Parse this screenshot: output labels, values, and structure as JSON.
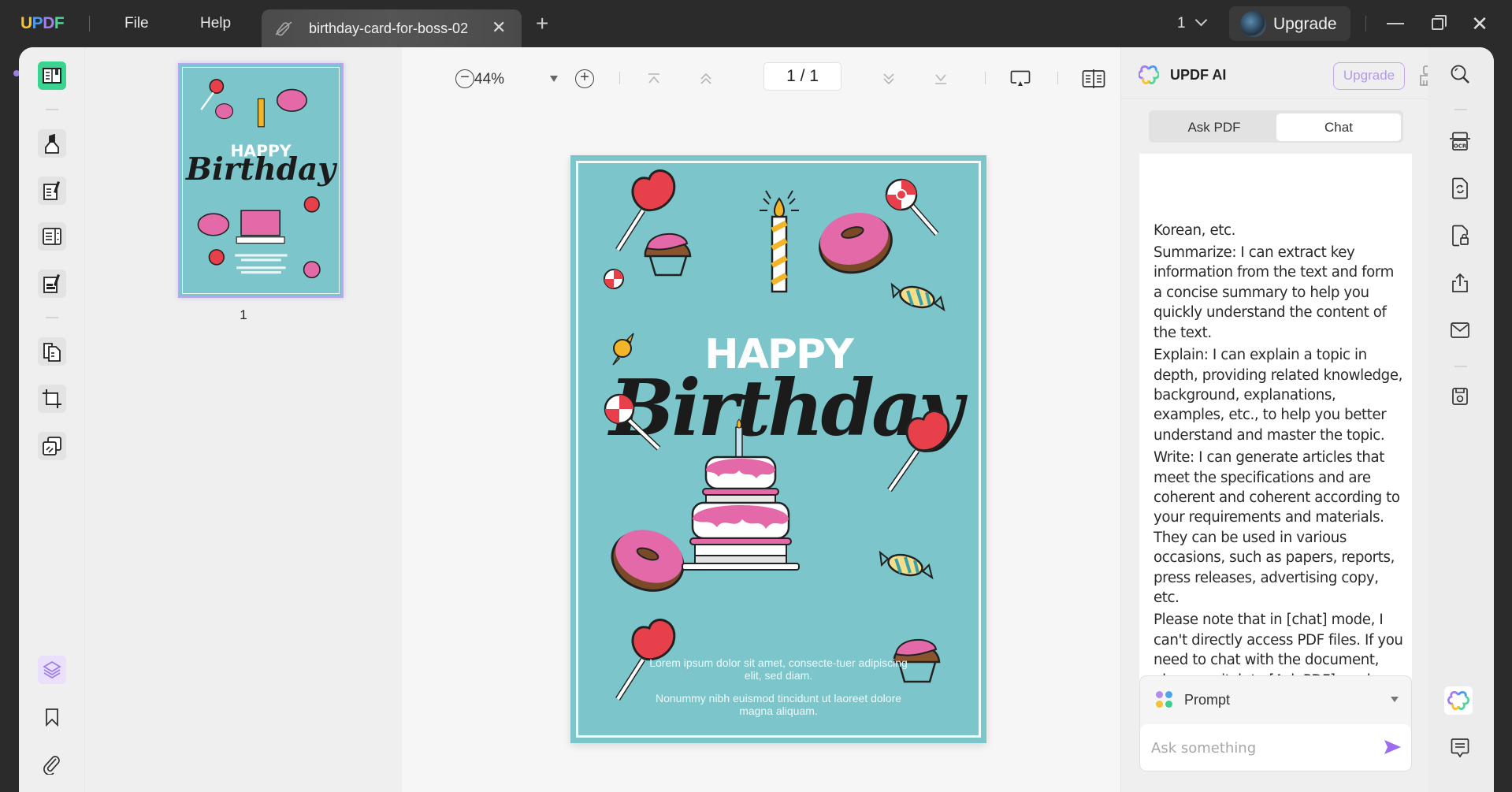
{
  "titlebar": {
    "logo_letters": [
      {
        "ch": "U",
        "color": "#f7c32e"
      },
      {
        "ch": "P",
        "color": "#4a9bf0"
      },
      {
        "ch": "D",
        "color": "#a37ef0"
      },
      {
        "ch": "F",
        "color": "#56d39a"
      }
    ],
    "menu": [
      "File",
      "Help"
    ],
    "tab_title": "birthday-card-for-boss-02",
    "tab_close": "✕",
    "new_tab": "+",
    "page_selector": "1",
    "upgrade_label": "Upgrade",
    "win_close": "✕"
  },
  "toolbar": {
    "zoom_out": "−",
    "zoom_value": "44%",
    "zoom_in": "+",
    "page_current": "1",
    "page_total": "1",
    "page_display": "1 / 1"
  },
  "thumbnails": [
    {
      "page_number": "1",
      "selected": true
    }
  ],
  "document": {
    "heading_top": "HAPPY",
    "heading_script": "Birthday",
    "body_paragraphs": [
      "Lorem ipsum dolor sit amet, consecte-tuer adipiscing elit, sed diam.",
      "Nonummy nibh euismod tincidunt ut laoreet dolore magna aliquam."
    ],
    "colors": {
      "background": "#7bc5cb",
      "heart": "#e8404a",
      "frosting": "#e469a8",
      "candle": "#f2b52a"
    }
  },
  "ai_panel": {
    "title": "UPDF AI",
    "upgrade_label": "Upgrade",
    "tabs": [
      {
        "label": "Ask PDF",
        "active": false
      },
      {
        "label": "Chat",
        "active": true
      }
    ],
    "messages": [
      "Korean, etc.",
      "Summarize: I can extract key information from the text and form a concise summary to help you quickly understand the content of the text.",
      "Explain: I can explain a topic in depth, providing related knowledge, background, explanations, examples, etc., to help you better understand and master the topic.",
      "Write: I can generate articles that meet the specifications and are coherent and coherent according to your requirements and materials. They can be used in various occasions, such as papers, reports, press releases, advertising copy, etc.",
      "Please note that in [chat] mode, I can't directly access PDF files. If you need to chat with the document, please switch to [Ask PDF] mode."
    ],
    "prompt_label": "Prompt",
    "input_placeholder": "Ask something",
    "input_value": ""
  },
  "colors": {
    "accent_purple": "#9d7ee9",
    "active_green": "#3ad38f",
    "titlebar_bg": "#2b2b2b"
  }
}
